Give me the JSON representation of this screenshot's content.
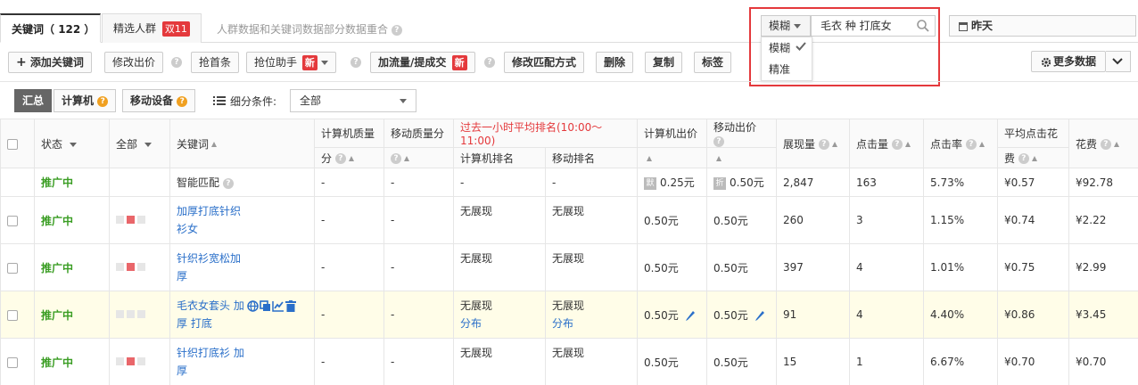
{
  "tabs": {
    "keywords_label": "关键词",
    "keywords_count": "（ 122 ）",
    "crowd_label": "精选人群",
    "crowd_badge": "双11",
    "note": "人群数据和关键词数据部分数据重合"
  },
  "search": {
    "match_mode": "模糊",
    "query": "毛衣 种 打底女",
    "options": [
      "模糊",
      "精准"
    ],
    "selected_option": "模糊"
  },
  "date": {
    "label": "昨天"
  },
  "toolbar": {
    "add_keyword": "添加关键词",
    "modify_bid": "修改出价",
    "grab_top": "抢首条",
    "grab_assist": "抢位助手",
    "new_badge": "新",
    "boost": "加流量/提成交",
    "modify_match": "修改匹配方式",
    "delete": "删除",
    "copy": "复制",
    "tag": "标签",
    "more_data": "更多数据"
  },
  "filter": {
    "summary": "汇总",
    "pc": "计算机",
    "mobile": "移动设备",
    "condition_label": "细分条件:",
    "condition_value": "全部"
  },
  "table": {
    "headers": {
      "status": "状态",
      "all": "全部",
      "keyword": "关键词",
      "pc_quality_1": "计算机质量",
      "pc_quality_2": "分",
      "mobile_quality": "移动质量分",
      "hour_rank": "过去一小时平均排名(10:00～11:00)",
      "pc_rank": "计算机排名",
      "mobile_rank": "移动排名",
      "pc_bid": "计算机出价",
      "mobile_bid": "移动出价",
      "impressions": "展现量",
      "clicks": "点击量",
      "ctr": "点击率",
      "avg_cpc_1": "平均点击花",
      "avg_cpc_2": "费",
      "cost": "花费"
    },
    "smart_row": {
      "status": "推广中",
      "keyword": "智能匹配",
      "pc_quality": "-",
      "mobile_quality": "-",
      "pc_rank": "-",
      "mobile_rank": "-",
      "pc_tag": "默",
      "pc_bid": "0.25元",
      "mobile_tag": "折",
      "mobile_bid": "0.50元",
      "impressions": "2,847",
      "clicks": "163",
      "ctr": "5.73%",
      "avg_cpc": "¥0.57",
      "cost": "¥92.78"
    },
    "rows": [
      {
        "status": "推广中",
        "keyword_1": "加厚打底针织",
        "keyword_2": "衫女",
        "pc_quality": "-",
        "mobile_quality": "-",
        "pc_rank": "无展现",
        "pc_rank_sub": "",
        "mobile_rank": "无展现",
        "mobile_rank_sub": "",
        "pc_bid": "0.50元",
        "mobile_bid": "0.50元",
        "impressions": "260",
        "clicks": "3",
        "ctr": "1.15%",
        "avg_cpc": "¥0.74",
        "cost": "¥2.22"
      },
      {
        "status": "推广中",
        "keyword_1": "针织衫宽松加",
        "keyword_2": "厚",
        "pc_quality": "-",
        "mobile_quality": "-",
        "pc_rank": "无展现",
        "pc_rank_sub": "",
        "mobile_rank": "无展现",
        "mobile_rank_sub": "",
        "pc_bid": "0.50元",
        "mobile_bid": "0.50元",
        "impressions": "397",
        "clicks": "4",
        "ctr": "1.01%",
        "avg_cpc": "¥0.75",
        "cost": "¥2.99"
      },
      {
        "status": "推广中",
        "keyword_1": "毛衣女套头 加",
        "keyword_2": "厚 打底",
        "pc_quality": "-",
        "mobile_quality": "-",
        "pc_rank": "无展现",
        "pc_rank_sub": "分布",
        "mobile_rank": "无展现",
        "mobile_rank_sub": "分布",
        "pc_bid": "0.50元",
        "mobile_bid": "0.50元",
        "impressions": "91",
        "clicks": "4",
        "ctr": "4.40%",
        "avg_cpc": "¥0.86",
        "cost": "¥3.45"
      },
      {
        "status": "推广中",
        "keyword_1": "针织打底衫 加",
        "keyword_2": "厚",
        "pc_quality": "-",
        "mobile_quality": "-",
        "pc_rank": "无展现",
        "pc_rank_sub": "",
        "mobile_rank": "无展现",
        "mobile_rank_sub": "",
        "pc_bid": "0.50元",
        "mobile_bid": "0.50元",
        "impressions": "15",
        "clicks": "1",
        "ctr": "6.67%",
        "avg_cpc": "¥0.70",
        "cost": "¥0.70"
      }
    ]
  },
  "colors": {
    "accent_red": "#e4393c",
    "status_green": "#3a9d23",
    "link_blue": "#2a6fc9",
    "highlight_row": "#fffde8"
  }
}
